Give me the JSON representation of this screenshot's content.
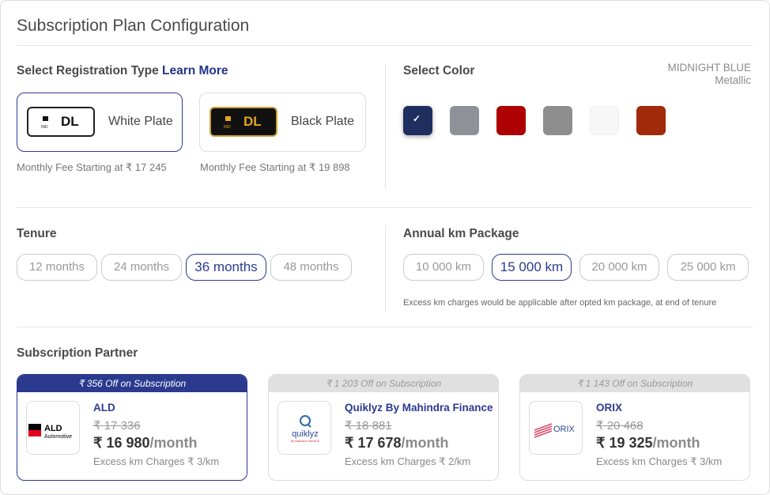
{
  "title": "Subscription Plan Configuration",
  "registration": {
    "label": "Select Registration Type",
    "learn_more": "Learn More",
    "options": [
      {
        "plate_text": "DL",
        "plate_ind": "IND",
        "name": "White Plate",
        "fee": "Monthly Fee Starting at ₹ 17 245",
        "selected": true
      },
      {
        "plate_text": "DL",
        "plate_ind": "IND",
        "name": "Black Plate",
        "fee": "Monthly Fee Starting at ₹ 19 898",
        "selected": false
      }
    ]
  },
  "color": {
    "label": "Select Color",
    "selected_name": "MIDNIGHT BLUE",
    "selected_finish": "Metallic",
    "swatches": [
      "#1e2e5e",
      "#8f9198",
      "#ae0000",
      "#8e8e8e",
      "#f7f7f7",
      "#a02a0a"
    ],
    "check_icon": "✓"
  },
  "tenure": {
    "label": "Tenure",
    "options": [
      "12 months",
      "24 months",
      "36 months",
      "48 months"
    ],
    "selected_index": 2
  },
  "km": {
    "label": "Annual km Package",
    "options": [
      "10 000 km",
      "15 000 km",
      "20 000 km",
      "25 000 km"
    ],
    "selected_index": 1,
    "note": "Excess km charges would be applicable after opted km package, at end of tenure"
  },
  "partner": {
    "label": "Subscription Partner",
    "cards": [
      {
        "banner": "₹ 356 Off on Subscription",
        "name": "ALD",
        "logo": "ald-automotive-logo",
        "logo_text": "ALD",
        "logo_sub": "Automotive",
        "old_price": "₹ 17 336",
        "price": "₹ 16 980",
        "unit": "/month",
        "excess": "Excess km Charges ₹ 3/km",
        "selected": true
      },
      {
        "banner": "₹ 1 203 Off on Subscription",
        "name": "Quiklyz By Mahindra Finance",
        "logo": "quiklyz-logo",
        "logo_text": "quiklyz",
        "logo_sub": "By Mahindra FINANCE",
        "old_price": "₹ 18 881",
        "price": "₹ 17 678",
        "unit": "/month",
        "excess": "Excess km Charges ₹ 2/km",
        "selected": false
      },
      {
        "banner": "₹ 1 143 Off on Subscription",
        "name": "ORIX",
        "logo": "orix-logo",
        "logo_text": "ORIX",
        "old_price": "₹ 20 468",
        "price": "₹ 19 325",
        "unit": "/month",
        "excess": "Excess km Charges ₹ 3/km",
        "selected": false
      }
    ]
  }
}
